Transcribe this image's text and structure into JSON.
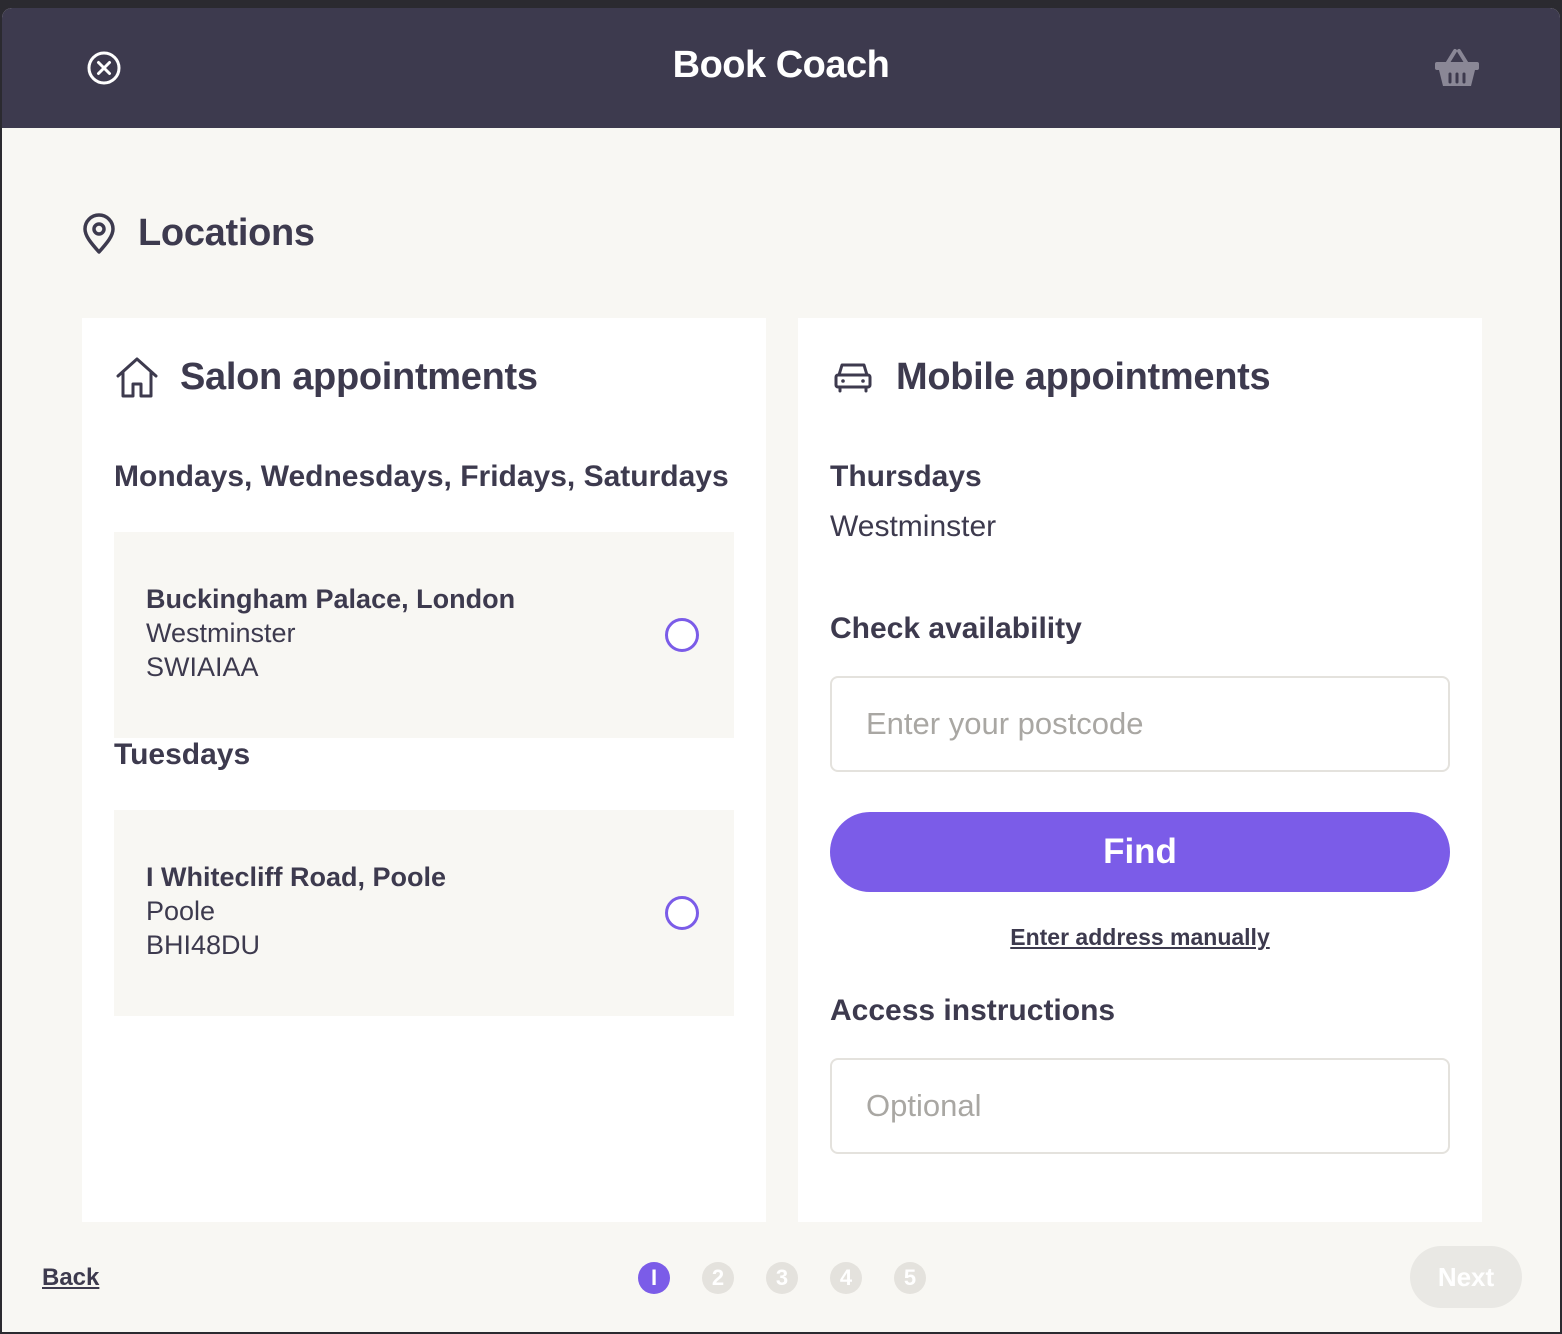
{
  "header": {
    "title": "Book Coach"
  },
  "section": {
    "title": "Locations"
  },
  "salon": {
    "title": "Salon appointments",
    "groups": [
      {
        "days": "Mondays, Wednesdays, Fridays, Saturdays",
        "location": {
          "name": "Buckingham Palace, London",
          "area": "Westminster",
          "postcode": "SWIAIAA"
        }
      },
      {
        "days": "Tuesdays",
        "location": {
          "name": "I Whitecliff Road, Poole",
          "area": "Poole",
          "postcode": "BHI48DU"
        }
      }
    ]
  },
  "mobile": {
    "title": "Mobile appointments",
    "days": "Thursdays",
    "area": "Westminster",
    "check_label": "Check availability",
    "postcode_placeholder": "Enter your postcode",
    "find_label": "Find",
    "manual_link": "Enter address manually",
    "access_label": "Access instructions",
    "access_placeholder": "Optional"
  },
  "footer": {
    "back_label": "Back",
    "steps": [
      "I",
      "2",
      "3",
      "4",
      "5"
    ],
    "current_step": 1,
    "next_label": "Next"
  },
  "colors": {
    "header_bg": "#3d3a4e",
    "accent": "#7b5ce8",
    "page_bg": "#f8f7f3",
    "text": "#3d3a4e"
  }
}
